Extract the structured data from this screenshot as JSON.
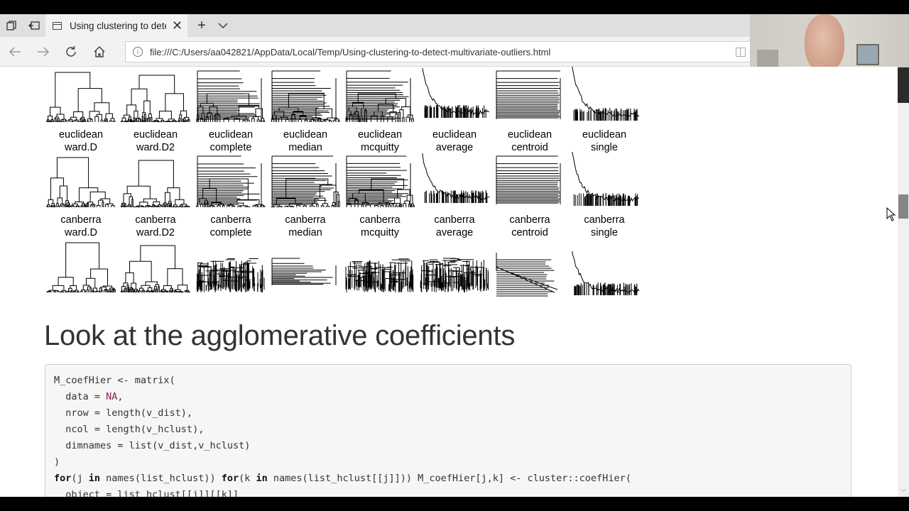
{
  "browser": {
    "tab_title": "Using clustering to dete",
    "url": "file:///C:/Users/aa042821/AppData/Local/Temp/Using-clustering-to-detect-multivariate-outliers.html",
    "new_tab_symbol": "+",
    "tab_list_symbol": "⌵",
    "tab_close_symbol": "✕"
  },
  "dendrogram_grid": {
    "rows": [
      {
        "distance": "euclidean",
        "methods": [
          "ward.D",
          "ward.D2",
          "complete",
          "median",
          "mcquitty",
          "average",
          "centroid",
          "single"
        ]
      },
      {
        "distance": "canberra",
        "methods": [
          "ward.D",
          "ward.D2",
          "complete",
          "median",
          "mcquitty",
          "average",
          "centroid",
          "single"
        ]
      }
    ]
  },
  "section_heading": "Look at the agglomerative coefficients",
  "code": {
    "lines": [
      [
        {
          "t": "M_coefHier <- matrix("
        }
      ],
      [
        {
          "t": "  data = "
        },
        {
          "t": "NA",
          "c": "na"
        },
        {
          "t": ","
        }
      ],
      [
        {
          "t": "  nrow = length(v_dist),"
        }
      ],
      [
        {
          "t": "  ncol = length(v_hclust),"
        }
      ],
      [
        {
          "t": "  dimnames = list(v_dist,v_hclust)"
        }
      ],
      [
        {
          "t": ")"
        }
      ],
      [
        {
          "t": "for",
          "c": "kw"
        },
        {
          "t": "(j "
        },
        {
          "t": "in",
          "c": "kw"
        },
        {
          "t": " names(list_hclust)) "
        },
        {
          "t": "for",
          "c": "kw"
        },
        {
          "t": "(k "
        },
        {
          "t": "in",
          "c": "kw"
        },
        {
          "t": " names(list_hclust[[j]])) M_coefHier[j,k] <- cluster::coefHier("
        }
      ],
      [
        {
          "t": "  object = list_hclust[[j]][[k]]"
        }
      ]
    ]
  }
}
